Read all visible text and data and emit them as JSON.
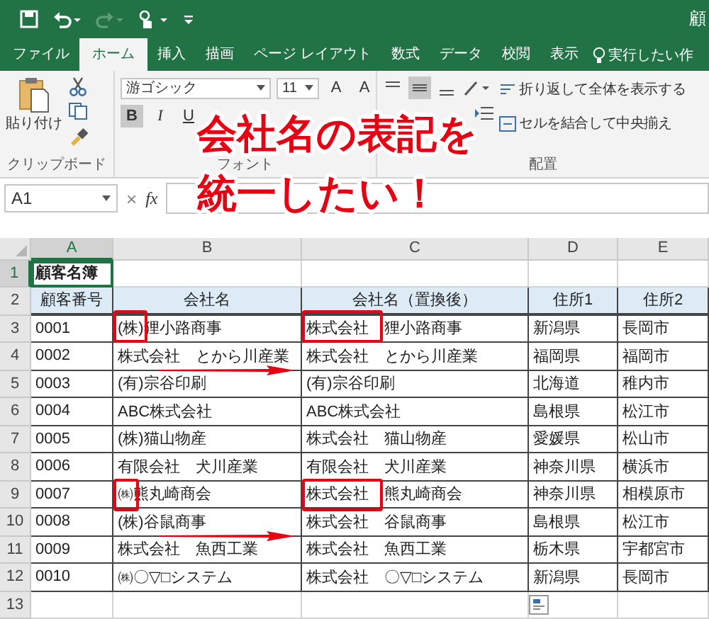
{
  "window": {
    "title": "顧"
  },
  "tabs": [
    {
      "label": "ファイル",
      "selected": false
    },
    {
      "label": "ホーム",
      "selected": true
    },
    {
      "label": "挿入",
      "selected": false
    },
    {
      "label": "描画",
      "selected": false
    },
    {
      "label": "ページ レイアウト",
      "selected": false
    },
    {
      "label": "数式",
      "selected": false
    },
    {
      "label": "データ",
      "selected": false
    },
    {
      "label": "校閲",
      "selected": false
    },
    {
      "label": "表示",
      "selected": false
    }
  ],
  "tell_me": {
    "placeholder": "実行したい作"
  },
  "ribbon": {
    "clipboard": {
      "paste": "貼り付け",
      "group": "クリップボード"
    },
    "font": {
      "name": "游ゴシック",
      "size": "11",
      "grow": "A",
      "shrink": "A",
      "bold": "B",
      "italic": "I",
      "underline": "U",
      "group": "フォント"
    },
    "alignment": {
      "wrap": "折り返して全体を表示する",
      "merge": "セルを結合して中央揃え",
      "group": "配置"
    }
  },
  "formula_bar": {
    "name_box": "A1",
    "cancel": "×",
    "fx": "fx"
  },
  "sheet": {
    "columns": [
      {
        "label": "A",
        "selected": true
      },
      {
        "label": "B",
        "selected": false
      },
      {
        "label": "C",
        "selected": false
      },
      {
        "label": "D",
        "selected": false
      },
      {
        "label": "E",
        "selected": false
      }
    ],
    "rows": [
      {
        "number": "1",
        "kind": "title",
        "selected": true,
        "cells": [
          "顧客名簿"
        ]
      },
      {
        "number": "2",
        "kind": "header",
        "selected": false,
        "cells": [
          "顧客番号",
          "会社名",
          "会社名（置換後）",
          "住所1",
          "住所2"
        ]
      },
      {
        "number": "3",
        "kind": "data",
        "selected": false,
        "cells": [
          "0001",
          "(株)狸小路商事",
          "株式会社　狸小路商事",
          "新潟県",
          "長岡市"
        ]
      },
      {
        "number": "4",
        "kind": "data",
        "selected": false,
        "cells": [
          "0002",
          "株式会社　とから川産業",
          "株式会社　とから川産業",
          "福岡県",
          "福岡市"
        ]
      },
      {
        "number": "5",
        "kind": "data",
        "selected": false,
        "cells": [
          "0003",
          "(有)宗谷印刷",
          "(有)宗谷印刷",
          "北海道",
          "稚内市"
        ]
      },
      {
        "number": "6",
        "kind": "data",
        "selected": false,
        "cells": [
          "0004",
          "ABC株式会社",
          "ABC株式会社",
          "島根県",
          "松江市"
        ]
      },
      {
        "number": "7",
        "kind": "data",
        "selected": false,
        "cells": [
          "0005",
          "(株)猫山物産",
          "株式会社　猫山物産",
          "愛媛県",
          "松山市"
        ]
      },
      {
        "number": "8",
        "kind": "data",
        "selected": false,
        "cells": [
          "0006",
          "有限会社　犬川産業",
          "有限会社　犬川産業",
          "神奈川県",
          "横浜市"
        ]
      },
      {
        "number": "9",
        "kind": "data",
        "selected": false,
        "cells": [
          "0007",
          "㈱熊丸崎商会",
          "株式会社　熊丸崎商会",
          "神奈川県",
          "相模原市"
        ]
      },
      {
        "number": "10",
        "kind": "data",
        "selected": false,
        "cells": [
          "0008",
          "(株)谷鼠商事",
          "株式会社　谷鼠商事",
          "島根県",
          "松江市"
        ]
      },
      {
        "number": "11",
        "kind": "data",
        "selected": false,
        "cells": [
          "0009",
          "株式会社　魚西工業",
          "株式会社　魚西工業",
          "栃木県",
          "宇都宮市"
        ]
      },
      {
        "number": "12",
        "kind": "data",
        "selected": false,
        "cells": [
          "0010",
          "㈱〇▽□システム",
          "株式会社　〇▽□システム",
          "新潟県",
          "長岡市"
        ]
      },
      {
        "number": "13",
        "kind": "empty",
        "selected": false,
        "cells": []
      }
    ]
  },
  "callout": [
    "会社名の表記を",
    "統一したい！"
  ]
}
